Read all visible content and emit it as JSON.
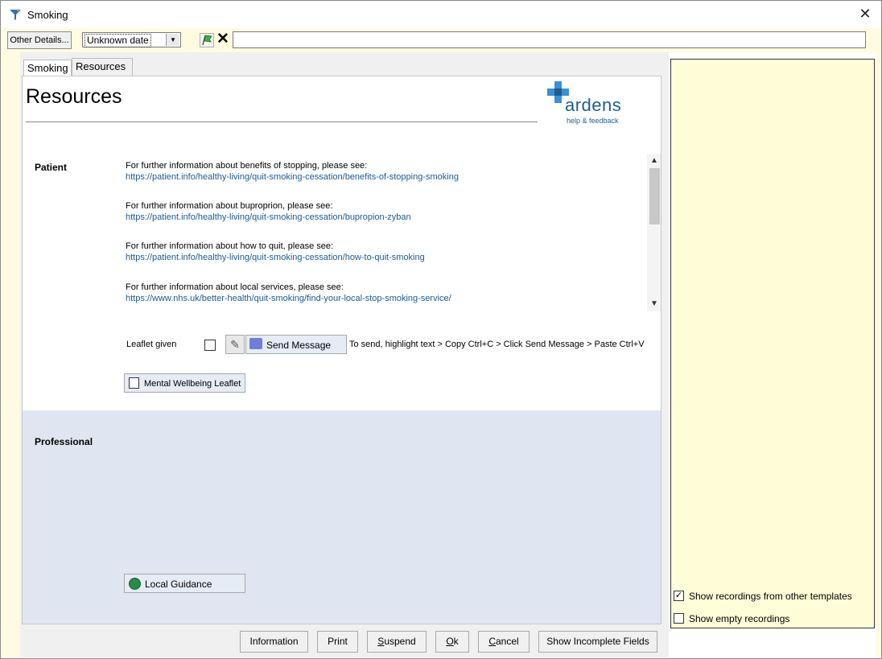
{
  "window": {
    "title": "Smoking",
    "close_glyph": "✕"
  },
  "toolbar": {
    "other_details_label": "Other Details...",
    "date_value": "Unknown date",
    "clear_glyph": "✕",
    "free_text_value": ""
  },
  "tabs": [
    {
      "label": "Smoking",
      "active": false
    },
    {
      "label": "Resources",
      "active": true
    }
  ],
  "page": {
    "heading": "Resources",
    "logo": {
      "word": "ardens",
      "sub": "help & feedback"
    }
  },
  "patient": {
    "label": "Patient",
    "items": [
      {
        "text": "For further information about benefits of stopping, please see:",
        "link": "https://patient.info/healthy-living/quit-smoking-cessation/benefits-of-stopping-smoking"
      },
      {
        "text": "For further information about buproprion, please see:",
        "link": "https://patient.info/healthy-living/quit-smoking-cessation/bupropion-zyban"
      },
      {
        "text": "For further information about how to quit, please see:",
        "link": "https://patient.info/healthy-living/quit-smoking-cessation/how-to-quit-smoking"
      },
      {
        "text": "For further information about local services, please see:",
        "link": "https://www.nhs.uk/better-health/quit-smoking/find-your-local-stop-smoking-service/"
      }
    ],
    "leaflet_label": "Leaflet given",
    "leaflet_checked": false,
    "send_message_label": "Send Message",
    "send_hint": "To send, highlight text > Copy Ctrl+C > Click Send Message > Paste Ctrl+V",
    "wellbeing_button": "Mental Wellbeing Leaflet"
  },
  "professional": {
    "label": "Professional",
    "guidance_button": "Local Guidance"
  },
  "buttons": {
    "information": "Information",
    "print": "Print",
    "suspend_u": "S",
    "suspend_rest": "uspend",
    "ok_u": "O",
    "ok_rest": "k",
    "cancel_u": "C",
    "cancel_rest": "ancel",
    "show_incomplete": "Show Incomplete Fields"
  },
  "right_panel": {
    "show_other_templates": "Show recordings from other templates",
    "show_other_templates_checked": true,
    "show_empty": "Show empty recordings",
    "show_empty_checked": false
  },
  "colors": {
    "link": "#1a5a96",
    "toolbar_bg": "#fffbe0",
    "right_panel_bg": "#fffdd8",
    "professional_bg": "#dfe6f1"
  },
  "icons": [
    "filter-logo-icon",
    "close-icon",
    "dropdown-arrow-icon",
    "green-flag-icon",
    "clear-x-icon",
    "pencil-icon",
    "message-icon",
    "document-icon",
    "url-globe-icon",
    "scroll-up-icon",
    "scroll-down-icon"
  ]
}
